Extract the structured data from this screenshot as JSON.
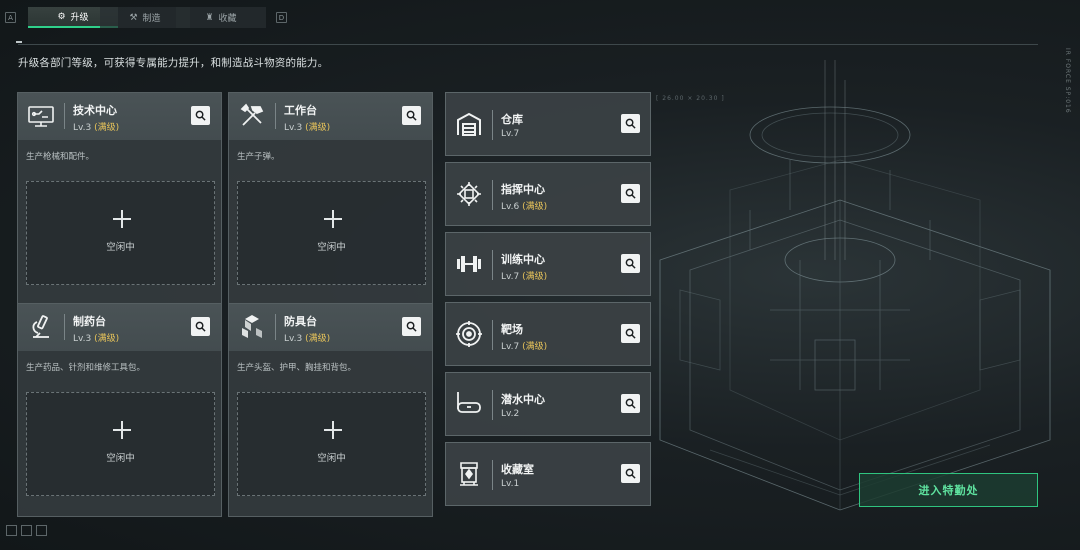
{
  "tabs": {
    "left_key": "A",
    "right_key": "D",
    "items": [
      {
        "label": "升级",
        "icon": "upgrade-icon",
        "active": true
      },
      {
        "label": "制造",
        "icon": "craft-icon",
        "active": false
      },
      {
        "label": "收藏",
        "icon": "collection-icon",
        "active": false
      }
    ]
  },
  "subtitle": "升级各部门等级，可获得专属能力提升，和制造战斗物资的能力。",
  "side_text": "IR FORCE SP:016",
  "coord": "[ 26.00 × 20.30 ]",
  "big_cards": [
    {
      "name": "技术中心",
      "level": "Lv.3",
      "max": "(满级)",
      "desc": "生产枪械和配件。",
      "slot_text": "空闲中",
      "icon": "tech-center-icon"
    },
    {
      "name": "工作台",
      "level": "Lv.3",
      "max": "(满级)",
      "desc": "生产子弹。",
      "slot_text": "空闲中",
      "icon": "workbench-icon"
    },
    {
      "name": "制药台",
      "level": "Lv.3",
      "max": "(满级)",
      "desc": "生产药品、针剂和维修工具包。",
      "slot_text": "空闲中",
      "icon": "pharmacy-icon"
    },
    {
      "name": "防具台",
      "level": "Lv.3",
      "max": "(满级)",
      "desc": "生产头盔、护甲、胸挂和背包。",
      "slot_text": "空闲中",
      "icon": "armor-bench-icon"
    }
  ],
  "small_cards": [
    {
      "name": "仓库",
      "level": "Lv.7",
      "max": "",
      "icon": "warehouse-icon"
    },
    {
      "name": "指挥中心",
      "level": "Lv.6",
      "max": "(满级)",
      "icon": "command-center-icon"
    },
    {
      "name": "训练中心",
      "level": "Lv.7",
      "max": "(满级)",
      "icon": "training-center-icon"
    },
    {
      "name": "靶场",
      "level": "Lv.7",
      "max": "(满级)",
      "icon": "shooting-range-icon"
    },
    {
      "name": "潜水中心",
      "level": "Lv.2",
      "max": "",
      "icon": "diving-center-icon"
    },
    {
      "name": "收藏室",
      "level": "Lv.1",
      "max": "",
      "icon": "collection-room-icon"
    }
  ],
  "enter_button": "进入特勤处",
  "colors": {
    "accent": "#2fd08a",
    "max_level": "#e8c45a"
  }
}
